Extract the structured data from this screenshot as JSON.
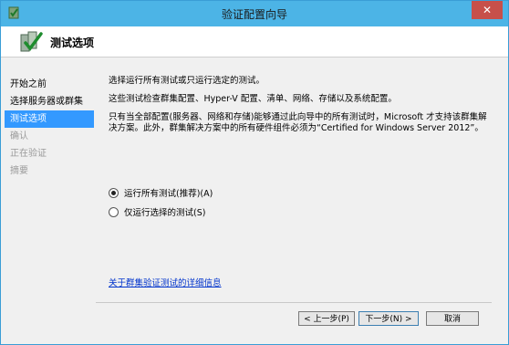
{
  "window": {
    "title": "验证配置向导",
    "close_label": "✕"
  },
  "header": {
    "title": "测试选项"
  },
  "sidebar": {
    "steps": [
      {
        "label": "开始之前",
        "state": "normal"
      },
      {
        "label": "选择服务器或群集",
        "state": "normal"
      },
      {
        "label": "测试选项",
        "state": "active"
      },
      {
        "label": "确认",
        "state": "disabled"
      },
      {
        "label": "正在验证",
        "state": "disabled"
      },
      {
        "label": "摘要",
        "state": "disabled"
      }
    ]
  },
  "main": {
    "intro": "选择运行所有测试或只运行选定的测试。",
    "description": "这些测试检查群集配置、Hyper-V 配置、清单、网络、存储以及系统配置。",
    "note": "只有当全部配置(服务器、网络和存储)能够通过此向导中的所有测试时，Microsoft 才支持该群集解决方案。此外，群集解决方案中的所有硬件组件必须为“Certified for Windows Server 2012”。",
    "options": [
      {
        "label": "运行所有测试(推荐)(A)",
        "selected": true
      },
      {
        "label": "仅运行选择的测试(S)",
        "selected": false
      }
    ],
    "link": "关于群集验证测试的详细信息"
  },
  "buttons": {
    "prev": "< 上一步(P)",
    "next": "下一步(N) >",
    "cancel": "取消"
  },
  "colors": {
    "titlebar": "#4cb4e6",
    "active_step": "#3399ff",
    "link": "#0033cc",
    "close": "#c7504a"
  }
}
